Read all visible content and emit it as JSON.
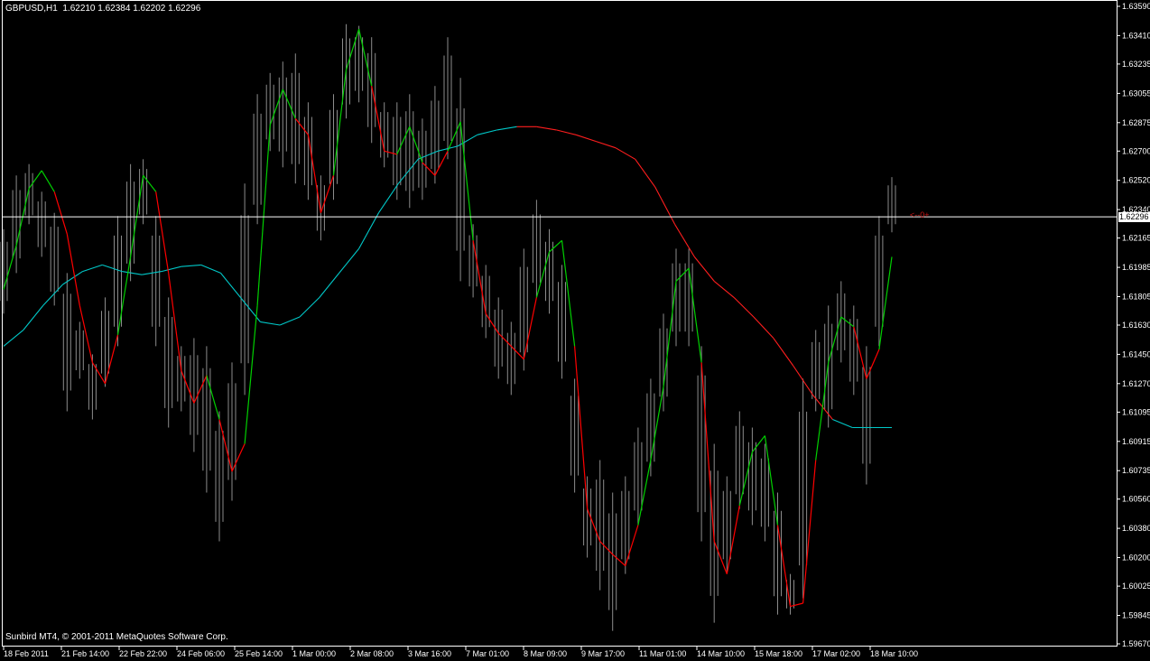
{
  "window": {
    "symbol_line": "GBPUSD,H1  1.62210 1.62384 1.62202 1.62296",
    "copyright": "Sunbird MT4, © 2001-2011 MetaQuotes Software Corp.",
    "current_price_label": "1.62296",
    "marker_text": "<--0+"
  },
  "colors": {
    "background": "#000000",
    "border": "#ffffff",
    "bars": "#8c8c8c",
    "ma_up": "#00d000",
    "ma_down": "#ff0000",
    "slow_ma": "#00c8c8",
    "slow_ma_down": "#ff1e1e",
    "price_line": "#ffffff",
    "marker": "#c81414"
  },
  "chart_data": {
    "type": "line",
    "title": "",
    "xlabel": "",
    "ylabel": "",
    "ylim": [
      1.5967,
      1.6359
    ],
    "y_ticks": [
      "1.63590",
      "1.63410",
      "1.63235",
      "1.63055",
      "1.62875",
      "1.62700",
      "1.62520",
      "1.62340",
      "1.62165",
      "1.61985",
      "1.61805",
      "1.61630",
      "1.61450",
      "1.61270",
      "1.61095",
      "1.60915",
      "1.60735",
      "1.60560",
      "1.60380",
      "1.60200",
      "1.60025",
      "1.59845",
      "1.59670"
    ],
    "x_ticks": [
      "18 Feb 2011",
      "21 Feb 14:00",
      "22 Feb 22:00",
      "24 Feb 06:00",
      "25 Feb 14:00",
      "1 Mar 00:00",
      "2 Mar 08:00",
      "3 Mar 16:00",
      "7 Mar 01:00",
      "8 Mar 09:00",
      "9 Mar 17:00",
      "11 Mar 01:00",
      "14 Mar 10:00",
      "15 Mar 18:00",
      "17 Mar 02:00",
      "18 Mar 10:00"
    ],
    "current_price": 1.62296,
    "fast_ma": [
      1.6185,
      1.6212,
      1.6247,
      1.6258,
      1.6245,
      1.6219,
      1.6175,
      1.614,
      1.6127,
      1.6157,
      1.6205,
      1.6255,
      1.6245,
      1.6195,
      1.6135,
      1.6115,
      1.6132,
      1.6105,
      1.6073,
      1.609,
      1.6175,
      1.6286,
      1.6308,
      1.629,
      1.628,
      1.6232,
      1.6255,
      1.632,
      1.6345,
      1.631,
      1.627,
      1.6268,
      1.6285,
      1.6263,
      1.6255,
      1.627,
      1.6288,
      1.6215,
      1.617,
      1.6158,
      1.615,
      1.6142,
      1.618,
      1.6208,
      1.6215,
      1.615,
      1.605,
      1.603,
      1.6022,
      1.6015,
      1.604,
      1.608,
      1.6125,
      1.619,
      1.6198,
      1.614,
      1.603,
      1.601,
      1.6052,
      1.6085,
      1.6095,
      1.604,
      1.599,
      1.5992,
      1.608,
      1.614,
      1.6168,
      1.6162,
      1.613,
      1.6148,
      1.6205
    ],
    "ma_direction": [
      "up",
      "up",
      "up",
      "up",
      "down",
      "down",
      "down",
      "down",
      "down",
      "up",
      "up",
      "up",
      "down",
      "down",
      "down",
      "down",
      "up",
      "down",
      "down",
      "up",
      "up",
      "up",
      "up",
      "down",
      "down",
      "down",
      "up",
      "up",
      "up",
      "down",
      "down",
      "up",
      "up",
      "down",
      "down",
      "up",
      "up",
      "down",
      "down",
      "down",
      "down",
      "down",
      "up",
      "up",
      "up",
      "down",
      "down",
      "down",
      "down",
      "down",
      "up",
      "up",
      "up",
      "up",
      "up",
      "down",
      "down",
      "down",
      "up",
      "up",
      "up",
      "down",
      "down",
      "down",
      "up",
      "up",
      "up",
      "down",
      "down",
      "up",
      "up"
    ],
    "slow_ma": [
      1.615,
      1.616,
      1.6175,
      1.6188,
      1.6196,
      1.62,
      1.6196,
      1.6194,
      1.6196,
      1.6199,
      1.62,
      1.6195,
      1.618,
      1.6165,
      1.6163,
      1.6168,
      1.618,
      1.6195,
      1.621,
      1.6232,
      1.625,
      1.6265,
      1.627,
      1.6273,
      1.628,
      1.6283,
      1.6285,
      1.6285,
      1.6283,
      1.628,
      1.6276,
      1.6272,
      1.6265,
      1.6248,
      1.6225,
      1.6205,
      1.619,
      1.618,
      1.6168,
      1.6155,
      1.6138,
      1.612,
      1.6105,
      1.61,
      1.61,
      1.61
    ],
    "slow_ma_up_until": 26,
    "price_hl": [
      [
        1.6222,
        1.617
      ],
      [
        1.6255,
        1.6195
      ],
      [
        1.6262,
        1.6225
      ],
      [
        1.6245,
        1.6205
      ],
      [
        1.6232,
        1.6175
      ],
      [
        1.6195,
        1.611
      ],
      [
        1.6165,
        1.613
      ],
      [
        1.6145,
        1.6105
      ],
      [
        1.618,
        1.6125
      ],
      [
        1.623,
        1.615
      ],
      [
        1.6262,
        1.619
      ],
      [
        1.6265,
        1.6225
      ],
      [
        1.623,
        1.615
      ],
      [
        1.618,
        1.61
      ],
      [
        1.615,
        1.611
      ],
      [
        1.6155,
        1.6085
      ],
      [
        1.615,
        1.606
      ],
      [
        1.611,
        1.603
      ],
      [
        1.614,
        1.6055
      ],
      [
        1.625,
        1.612
      ],
      [
        1.6305,
        1.6225
      ],
      [
        1.6318,
        1.627
      ],
      [
        1.6325,
        1.626
      ],
      [
        1.633,
        1.625
      ],
      [
        1.63,
        1.624
      ],
      [
        1.6255,
        1.6215
      ],
      [
        1.6305,
        1.624
      ],
      [
        1.6348,
        1.629
      ],
      [
        1.6347,
        1.63
      ],
      [
        1.634,
        1.6275
      ],
      [
        1.63,
        1.626
      ],
      [
        1.63,
        1.624
      ],
      [
        1.6305,
        1.6235
      ],
      [
        1.629,
        1.624
      ],
      [
        1.631,
        1.625
      ],
      [
        1.634,
        1.6265
      ],
      [
        1.6315,
        1.619
      ],
      [
        1.6225,
        1.618
      ],
      [
        1.62,
        1.6155
      ],
      [
        1.618,
        1.613
      ],
      [
        1.6165,
        1.612
      ],
      [
        1.621,
        1.6135
      ],
      [
        1.624,
        1.618
      ],
      [
        1.6222,
        1.617
      ],
      [
        1.62,
        1.613
      ],
      [
        1.613,
        1.606
      ],
      [
        1.607,
        1.602
      ],
      [
        1.608,
        1.6
      ],
      [
        1.606,
        1.5975
      ],
      [
        1.607,
        1.601
      ],
      [
        1.61,
        1.604
      ],
      [
        1.613,
        1.607
      ],
      [
        1.617,
        1.611
      ],
      [
        1.621,
        1.615
      ],
      [
        1.621,
        1.615
      ],
      [
        1.615,
        1.603
      ],
      [
        1.609,
        1.598
      ],
      [
        1.607,
        1.601
      ],
      [
        1.611,
        1.605
      ],
      [
        1.61,
        1.604
      ],
      [
        1.609,
        1.603
      ],
      [
        1.606,
        1.5985
      ],
      [
        1.601,
        1.5985
      ],
      [
        1.613,
        1.5995
      ],
      [
        1.616,
        1.611
      ],
      [
        1.6175,
        1.61
      ],
      [
        1.619,
        1.614
      ],
      [
        1.6175,
        1.612
      ],
      [
        1.615,
        1.6065
      ],
      [
        1.623,
        1.615
      ],
      [
        1.6254,
        1.622
      ]
    ]
  }
}
